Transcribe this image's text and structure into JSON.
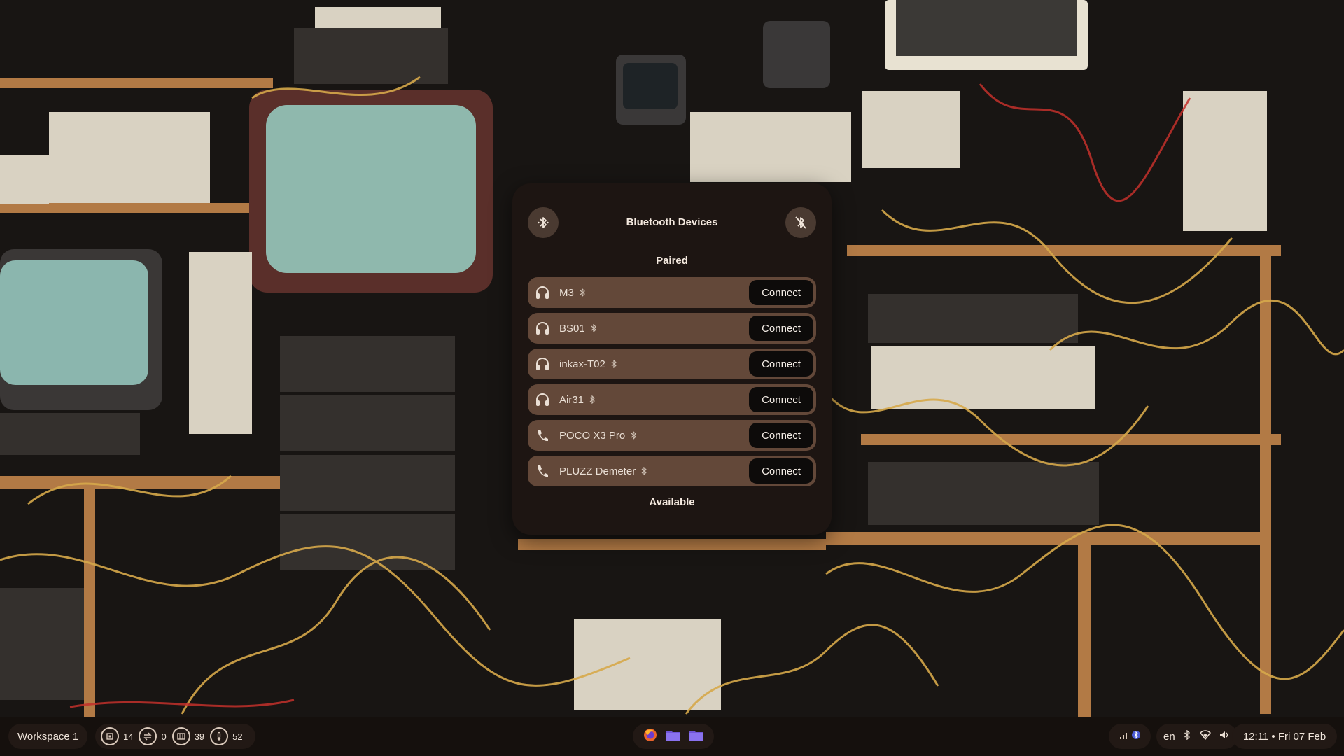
{
  "popup": {
    "title": "Bluetooth Devices",
    "paired_label": "Paired",
    "available_label": "Available",
    "devices": [
      {
        "name": "M3",
        "icon": "headphones-icon",
        "button": "Connect"
      },
      {
        "name": "BS01",
        "icon": "headphones-icon",
        "button": "Connect"
      },
      {
        "name": "inkax-T02",
        "icon": "headphones-icon",
        "button": "Connect"
      },
      {
        "name": "Air31",
        "icon": "headphones-icon",
        "button": "Connect"
      },
      {
        "name": "POCO X3 Pro",
        "icon": "phone-icon",
        "button": "Connect"
      },
      {
        "name": "PLUZZ Demeter",
        "icon": "phone-icon",
        "button": "Connect"
      }
    ]
  },
  "taskbar": {
    "workspace": "Workspace 1",
    "stats": {
      "cpu": "14",
      "swap": "0",
      "memory": "39",
      "temperature": "52"
    },
    "dock": [
      "firefox-icon",
      "folder-icon",
      "folder-icon"
    ],
    "language": "en",
    "clock": "12:11 • Fri 07 Feb"
  },
  "colors": {
    "panel_bg": "#1d1512",
    "row_bg": "#634839",
    "button_bg": "#0d0b0a",
    "taskbar_bg": "#15100d",
    "accent_purple": "#6f55d6"
  }
}
